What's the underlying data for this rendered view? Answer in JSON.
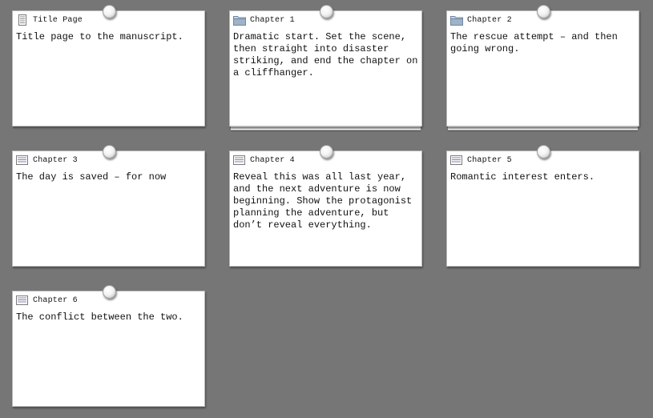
{
  "corkboard": {
    "cards": [
      {
        "title": "Title Page",
        "icon": "document-icon",
        "synopsis": "Title page to the manuscript.",
        "stacked": false
      },
      {
        "title": "Chapter 1",
        "icon": "folder-icon",
        "synopsis": "Dramatic start. Set the scene, then straight into disaster striking, and end the chapter on a cliffhanger.",
        "stacked": true
      },
      {
        "title": "Chapter 2",
        "icon": "folder-icon",
        "synopsis": "The rescue attempt – and then going wrong.",
        "stacked": true
      },
      {
        "title": "Chapter 3",
        "icon": "text-lines-icon",
        "synopsis": "The day is saved – for now",
        "stacked": false
      },
      {
        "title": "Chapter 4",
        "icon": "text-lines-icon",
        "synopsis": "Reveal this was all last year, and the next adventure is now beginning. Show the protagonist planning the adventure, but don’t reveal everything.",
        "stacked": false
      },
      {
        "title": "Chapter 5",
        "icon": "text-lines-icon",
        "synopsis": "Romantic interest enters.",
        "stacked": false
      },
      {
        "title": "Chapter 6",
        "icon": "text-lines-icon",
        "synopsis": "The conflict between the two.",
        "stacked": false
      }
    ]
  },
  "colors": {
    "background": "#767676",
    "card": "#ffffff",
    "pin": "#e8e8e8",
    "folder_icon": "#9fb3c8"
  }
}
